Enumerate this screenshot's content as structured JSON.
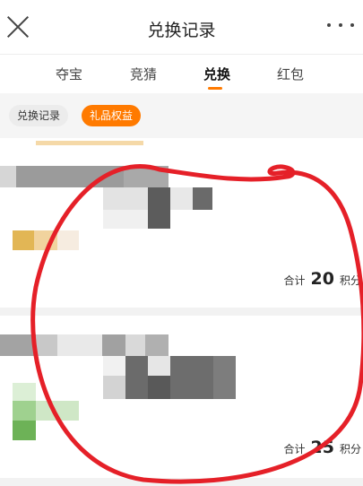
{
  "header": {
    "title": "兑换记录",
    "close_icon": "close-icon",
    "more_icon": "more-icon"
  },
  "tabs": [
    {
      "label": "夺宝",
      "active": false
    },
    {
      "label": "竞猜",
      "active": false
    },
    {
      "label": "兑换",
      "active": true
    },
    {
      "label": "红包",
      "active": false
    }
  ],
  "chips": {
    "records": "兑换记录",
    "gifts": "礼品权益"
  },
  "records": [
    {
      "total_label": "合计",
      "points": "20",
      "unit": "积分"
    },
    {
      "total_label": "合计",
      "points": "25",
      "unit": "积分"
    }
  ],
  "colors": {
    "accent": "#ff7a00",
    "circle": "#e52028"
  }
}
